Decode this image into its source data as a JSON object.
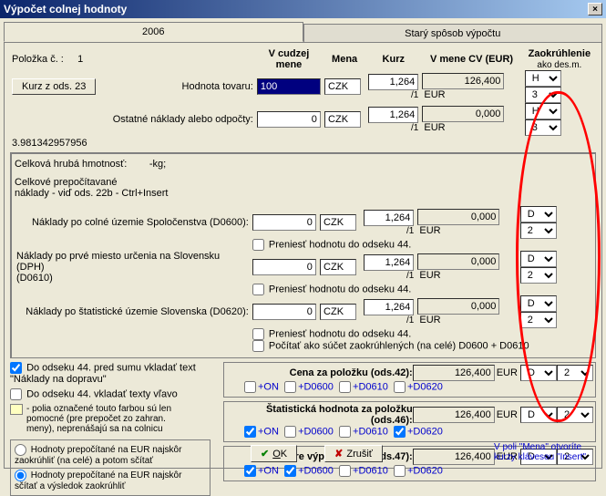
{
  "window": {
    "title": "Výpočet colnej hodnoty"
  },
  "tabs": {
    "active": "2006",
    "inactive": "Starý spôsob výpočtu"
  },
  "header": {
    "polozka_label": "Položka č. :",
    "polozka_no": "1",
    "btn_kurz": "Kurz z ods. 23",
    "col_cudzej": "V cudzej mene",
    "col_mena": "Mena",
    "col_kurz": "Kurz",
    "col_eur": "V mene CV (EUR)",
    "col_zaok": "Zaokrúhlenie",
    "col_zaok_sub": "ako        des.m."
  },
  "rows": {
    "tovar_label": "Hodnota tovaru:",
    "tovar_val": "100",
    "tovar_mena": "CZK",
    "tovar_kurz": "1,264",
    "tovar_div": "/1",
    "tovar_eur": "126,400",
    "tovar_z1": "H",
    "tovar_z2": "3",
    "naklady_label": "Ostatné náklady alebo odpočty:",
    "naklady_val": "0",
    "naklady_mena": "CZK",
    "naklady_kurz": "1,264",
    "naklady_div": "/1",
    "naklady_eur": "0,000",
    "naklady_z1": "H",
    "naklady_z2": "3",
    "decimal_note": "3.981342957956"
  },
  "block": {
    "hrub": "Celková hrubá hmotnosť:",
    "hrub_val": "-kg;",
    "prepoc": "Celkové prepočítavané",
    "prepoc2": "náklady - viď ods. 22b - Ctrl+Insert",
    "d0600_lbl": "Náklady po colné územie Spoločenstva (D0600):",
    "d0600_val": "0",
    "d0600_mena": "CZK",
    "d0600_kurz": "1,264",
    "d0600_div": "/1",
    "d0600_eur": "0,000",
    "d0600_cb": "Preniesť hodnotu do odseku 44.",
    "d0600_z1": "D",
    "d0600_z2": "2",
    "d0610_lbl1": "Náklady po prvé miesto určenia na Slovensku (DPH)",
    "d0610_lbl2": "(D0610)",
    "d0610_val": "0",
    "d0610_mena": "CZK",
    "d0610_kurz": "1,264",
    "d0610_div": "/1",
    "d0610_eur": "0,000",
    "d0610_cb": "Preniesť hodnotu do odseku 44.",
    "d0610_z1": "D",
    "d0610_z2": "2",
    "d0620_lbl": "Náklady po štatistické územie Slovenska (D0620):",
    "d0620_val": "0",
    "d0620_mena": "CZK",
    "d0620_kurz": "1,264",
    "d0620_div": "/1",
    "d0620_eur": "0,000",
    "d0620_cb1": "Preniesť hodnotu do odseku 44.",
    "d0620_cb2": "Počítať ako súčet zaokrúhlených (na celé) D0600 + D0610",
    "d0620_z1": "D",
    "d0620_z2": "2"
  },
  "left_opts": {
    "cb1": "Do odseku 44. pred sumu vkladať text \"Náklady na dopravu\"",
    "cb2": "Do odseku 44. vkladať texty vľavo",
    "yellow_note1": "- polia označené touto farbou sú len",
    "yellow_note2": "pomocné (pre prepočet zo zahran.",
    "yellow_note3": "meny), neprenášajú sa na colnicu",
    "rad1": "Hodnoty prepočítané na EUR najskôr zaokrúhliť (na celé) a potom sčítať",
    "rad2": "Hodnoty prepočítané na EUR najskôr sčítať a výsledok zaokrúhliť"
  },
  "sections": {
    "s42_title": "Cena za položku (ods.42):",
    "s42_val": "126,400",
    "s42_z1": "D",
    "s42_z2": "2",
    "s46_title": "Štatistická hodnota za položku (ods.46):",
    "s46_val": "126,400",
    "s46_z1": "D",
    "s46_z2": "2",
    "s47_title": "Základ pre výpočet CLA (ods.47):",
    "s47_val": "126,400",
    "s47_z1": "D",
    "s47_z2": "2",
    "chk_on": "+ON",
    "chk_d0600": "+D0600",
    "chk_d0610": "+D0610",
    "chk_d0620": "+D0620"
  },
  "buttons": {
    "ok": "OK",
    "cancel": "Zrušiť"
  },
  "footer": "V poli \"Mena\" otvoríte kurzy klávesou \"Insert\"",
  "eur": "EUR"
}
